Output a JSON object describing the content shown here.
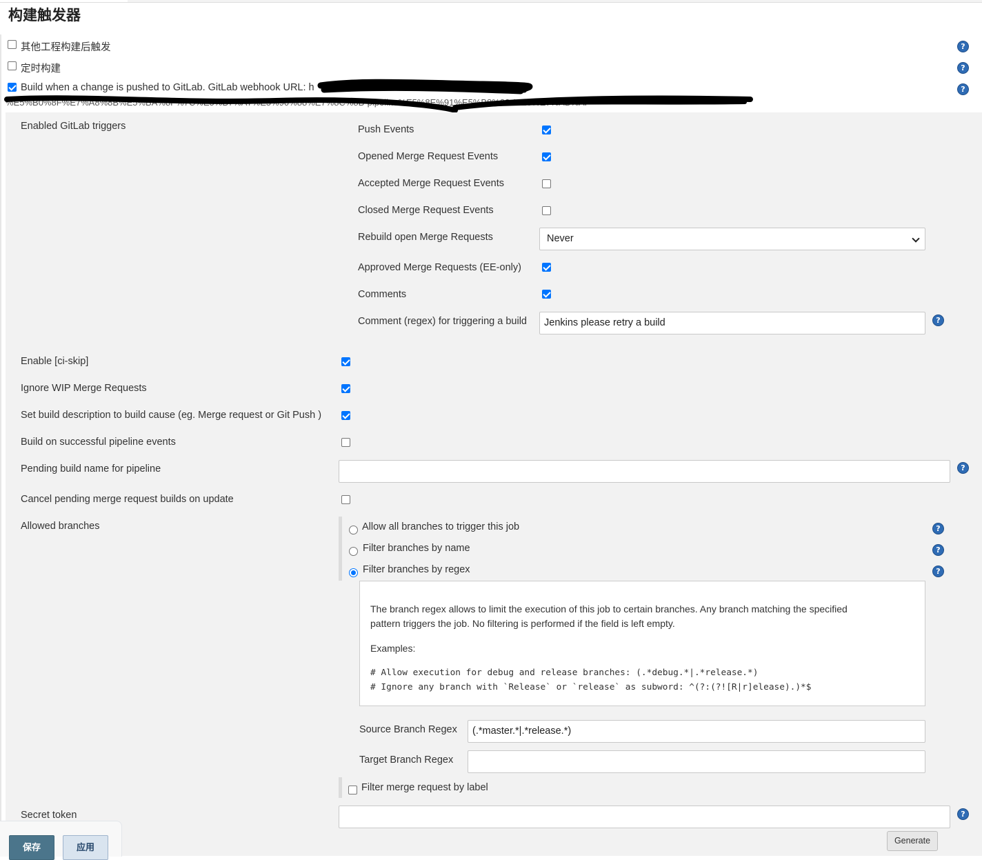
{
  "section": {
    "title": "构建触发器"
  },
  "triggers": [
    {
      "label": "其他工程构建后触发",
      "checked": false
    },
    {
      "label": "定时构建",
      "checked": false
    },
    {
      "label": "Build when a change is pushed to GitLab. GitLab webhook URL: h",
      "checked": true
    }
  ],
  "webhook_url_fragment": "%E5%B0%8F%E7%A8%8B%E5%BA%8F%7C%E5%B7%A7%E5%90%88%E7%8C%8B-pipeline%E5%8E%91%E5%B8%83-%E5%E7%AB%AF",
  "enabled_triggers": {
    "heading": "Enabled GitLab triggers",
    "items": [
      {
        "label": "Push Events",
        "checked": true
      },
      {
        "label": "Opened Merge Request Events",
        "checked": true
      },
      {
        "label": "Accepted Merge Request Events",
        "checked": false
      },
      {
        "label": "Closed Merge Request Events",
        "checked": false
      },
      {
        "label": "Rebuild open Merge Requests",
        "select_value": "Never"
      },
      {
        "label": "Approved Merge Requests (EE-only)",
        "checked": true
      },
      {
        "label": "Comments",
        "checked": true
      },
      {
        "label": "Comment (regex) for triggering a build",
        "value": "Jenkins please retry a build"
      }
    ]
  },
  "options": [
    {
      "label": "Enable [ci-skip]",
      "checked": true
    },
    {
      "label": "Ignore WIP Merge Requests",
      "checked": true
    },
    {
      "label": "Set build description to build cause (eg. Merge request or Git Push )",
      "checked": true
    },
    {
      "label": "Build on successful pipeline events",
      "checked": false
    },
    {
      "label": "Pending build name for pipeline",
      "value": ""
    },
    {
      "label": "Cancel pending merge request builds on update",
      "checked": false
    }
  ],
  "allowed_branches": {
    "heading": "Allowed branches",
    "radios": [
      {
        "label": "Allow all branches to trigger this job",
        "selected": false
      },
      {
        "label": "Filter branches by name",
        "selected": false
      },
      {
        "label": "Filter branches by regex",
        "selected": true
      }
    ],
    "help": {
      "paragraph1": "The branch regex allows to limit the execution of this job to certain branches. Any branch matching the specified",
      "paragraph2": "pattern triggers the job. No filtering is performed if the field is left empty.",
      "examples_label": "Examples:",
      "example1": "# Allow execution for debug and release branches: (.*debug.*|.*release.*)",
      "example2": "# Ignore any branch with `Release` or `release` as subword: ^(?:(?![R|r]elease).)*$"
    },
    "source_regex_label": "Source Branch Regex",
    "source_regex_value": "(.*master.*|.*release.*)",
    "target_regex_label": "Target Branch Regex",
    "target_regex_value": "",
    "label_filter": {
      "label": "Filter merge request by label",
      "checked": false
    }
  },
  "secret_token": {
    "label": "Secret token",
    "value": ""
  },
  "buttons": {
    "save": "保存",
    "apply": "应用",
    "generate": "Generate"
  },
  "help_icon_glyph": "?",
  "colors": {
    "accent": "#0075ff",
    "help": "#2f6cb5",
    "save_button": "#4b758b",
    "panel": "#f2f2f2"
  }
}
